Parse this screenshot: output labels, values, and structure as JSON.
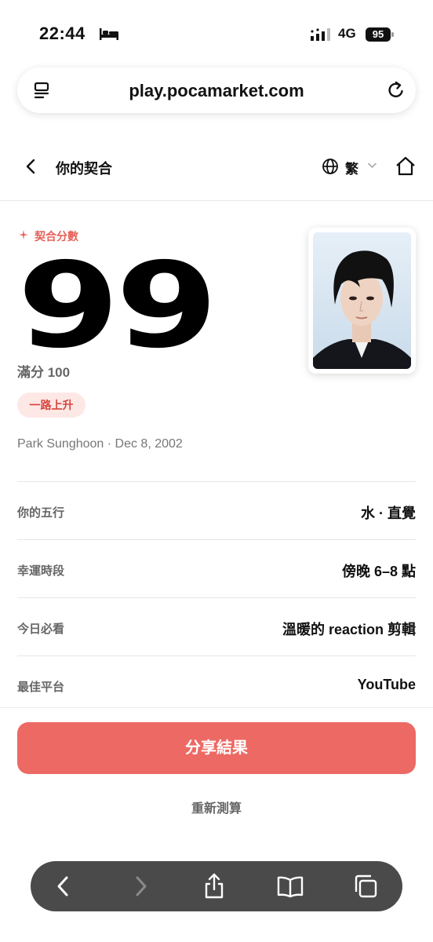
{
  "status_bar": {
    "time": "22:44",
    "network": "4G",
    "battery": "95"
  },
  "browser": {
    "url": "play.pocamarket.com"
  },
  "header": {
    "title": "你的契合",
    "language": "繁"
  },
  "score": {
    "label": "契合分數",
    "value": "99",
    "max_text": "滿分 100",
    "trend_badge": "一路上升",
    "meta": "Park Sunghoon · Dec 8, 2002"
  },
  "details": [
    {
      "label": "你的五行",
      "value": "水 · 直覺"
    },
    {
      "label": "幸運時段",
      "value": "傍晚 6–8 點"
    },
    {
      "label": "今日必看",
      "value": "溫暖的 reaction 剪輯"
    },
    {
      "label": "最佳平台",
      "value": "YouTube"
    }
  ],
  "actions": {
    "share": "分享結果",
    "recalculate": "重新測算"
  },
  "colors": {
    "accent": "#ec6964",
    "badge_bg": "#fde8e6",
    "badge_text": "#d8453d"
  }
}
